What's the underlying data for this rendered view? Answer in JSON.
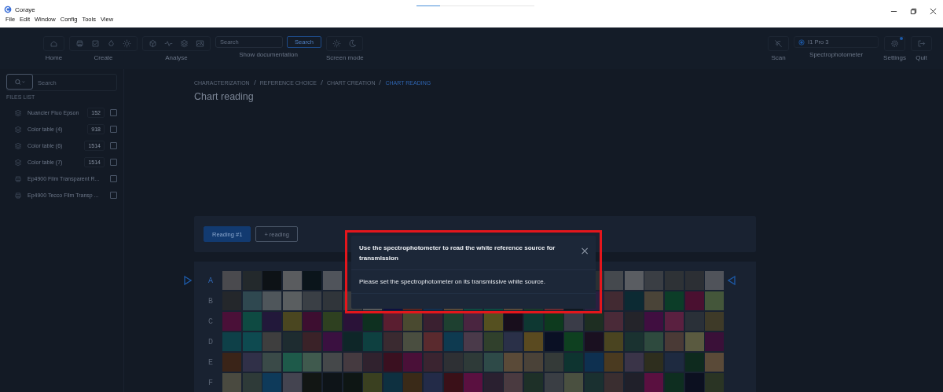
{
  "window": {
    "title": "Coraye",
    "menu": [
      "File",
      "Edit",
      "Window",
      "Config",
      "Tools",
      "View"
    ]
  },
  "toolbar": {
    "groups": [
      {
        "kind": "home",
        "label": "Home"
      },
      {
        "kind": "create",
        "label": "Create"
      },
      {
        "kind": "analyse",
        "label": "Analyse"
      }
    ],
    "search": {
      "placeholder": "Search",
      "button": "Search",
      "caption": "Show documentation"
    },
    "screen_mode": {
      "label": "Screen mode"
    },
    "scan": {
      "label": "Scan"
    },
    "spectrophotometer": {
      "value": "I1 Pro 3",
      "label": "Spectrophotometer",
      "connected": true
    },
    "settings": {
      "label": "Settings",
      "notification": true
    },
    "quit": {
      "label": "Quit"
    }
  },
  "sidebar": {
    "search": {
      "placeholder": "Search"
    },
    "heading": "FILES LIST",
    "files": [
      {
        "kind": "layers",
        "name": "Nuancier Fluo Epson",
        "count": "152",
        "checked": false
      },
      {
        "kind": "layers",
        "name": "Color table (4)",
        "count": "918",
        "checked": false
      },
      {
        "kind": "layers",
        "name": "Color table (6)",
        "count": "1514",
        "checked": false
      },
      {
        "kind": "layers",
        "name": "Color table (7)",
        "count": "1514",
        "checked": false
      },
      {
        "kind": "printer",
        "name": "Ep4900 Film Transparent R...",
        "checked": false
      },
      {
        "kind": "printer",
        "name": "Ep4900 Tecco Film Transp ...",
        "checked": false
      }
    ]
  },
  "breadcrumb": [
    {
      "label": "CHARACTERIZATION",
      "selected": false
    },
    {
      "label": "REFERENCE CHOICE",
      "selected": false
    },
    {
      "label": "CHART CREATION",
      "selected": false
    },
    {
      "label": "CHART READING",
      "selected": true
    }
  ],
  "page_title": "Chart reading",
  "readings": [
    {
      "label": "Reading #1",
      "selected": true
    },
    {
      "label": "+ reading",
      "selected": false
    }
  ],
  "chart": {
    "rows": [
      {
        "label": "A",
        "selected": true,
        "cells": [
          {
            "color": "#4a4a4e"
          },
          {
            "color": "#23292c"
          },
          {
            "color": "#0d1216"
          },
          {
            "color": "#5a5c5f"
          },
          {
            "color": "#0b151b"
          },
          {
            "color": "#50545b"
          },
          null,
          null,
          null,
          null,
          null,
          null,
          null,
          null,
          null,
          null,
          null,
          null,
          {
            "color": "#2b3034"
          },
          {
            "color": "#45494e"
          },
          {
            "color": "#5a5d62"
          },
          {
            "color": "#3a3e44"
          },
          {
            "color": "#2e3236"
          },
          {
            "color": "#2c2f34"
          },
          {
            "color": "#50535a"
          }
        ]
      },
      {
        "label": "B",
        "selected": false,
        "cells": [
          {
            "color": "#24272b"
          },
          {
            "color": "#2f4850"
          },
          {
            "color": "#4f565b"
          },
          {
            "color": "#5a5e60"
          },
          {
            "color": "#3a3f45"
          },
          {
            "color": "#30353a"
          },
          {
            "color": "#3a3d40"
          },
          {
            "color": "#5a5a5a"
          },
          {
            "color": "#0e1040"
          },
          {
            "color": "#5a2520"
          },
          {
            "color": "#123050"
          },
          {
            "color": "#5a4a38"
          },
          {
            "color": "#0f4a40"
          },
          {
            "color": "#0d4a40"
          },
          {
            "color": "#5a4a38"
          },
          {
            "color": "#1a3a2a"
          },
          {
            "color": "#6a2a30"
          },
          {
            "color": "#101820"
          },
          {
            "color": "#2a2040"
          },
          {
            "color": "#422a32"
          },
          {
            "color": "#0c2a33"
          },
          {
            "color": "#4a4438"
          },
          {
            "color": "#0c3d28"
          },
          {
            "color": "#4a1030"
          },
          {
            "color": "#44563a"
          }
        ]
      },
      {
        "label": "C",
        "selected": false,
        "cells": [
          {
            "color": "#4a1038"
          },
          {
            "color": "#0e4a42"
          },
          {
            "color": "#22183a"
          },
          {
            "color": "#4a4620"
          },
          {
            "color": "#3d0e30"
          },
          {
            "color": "#2e4020"
          },
          {
            "color": "#2a1238"
          },
          {
            "color": "#0e3020"
          },
          {
            "color": "#5a1e30"
          },
          {
            "color": "#4a4a30"
          },
          {
            "color": "#3a2030"
          },
          {
            "color": "#1e4030"
          },
          {
            "color": "#4a2540"
          },
          {
            "color": "#555020"
          },
          {
            "color": "#180e1c"
          },
          {
            "color": "#0e3832"
          },
          {
            "color": "#0d3a1e"
          },
          {
            "color": "#3a3c48"
          },
          {
            "color": "#1e2e22"
          },
          {
            "color": "#4a2a38"
          },
          {
            "color": "#24242a"
          },
          {
            "color": "#400e40"
          },
          {
            "color": "#5a2040"
          },
          {
            "color": "#2a3038"
          },
          {
            "color": "#3e3a28"
          }
        ]
      },
      {
        "label": "D",
        "selected": false,
        "cells": [
          {
            "color": "#0e4048"
          },
          {
            "color": "#0e4a50"
          },
          {
            "color": "#3e3e3e"
          },
          {
            "color": "#1e2c30"
          },
          {
            "color": "#3a2228"
          },
          {
            "color": "#3a1040"
          },
          {
            "color": "#0e2628"
          },
          {
            "color": "#0e4040"
          },
          {
            "color": "#3a2a30"
          },
          {
            "color": "#4a4e40"
          },
          {
            "color": "#5a2a2e"
          },
          {
            "color": "#0e3a50"
          },
          {
            "color": "#4a3a4a"
          },
          {
            "color": "#30402c"
          },
          {
            "color": "#2a3048"
          },
          {
            "color": "#5a4a20"
          },
          {
            "color": "#0a1024"
          },
          {
            "color": "#0e4020"
          },
          {
            "color": "#1a1020"
          },
          {
            "color": "#4a4420"
          },
          {
            "color": "#1a3230"
          },
          {
            "color": "#2e4a3e"
          },
          {
            "color": "#4a3a36"
          },
          {
            "color": "#5a5a40"
          },
          {
            "color": "#3a1038"
          }
        ]
      },
      {
        "label": "E",
        "selected": false,
        "cells": [
          {
            "color": "#3a2418"
          },
          {
            "color": "#303048"
          },
          {
            "color": "#3a4a48"
          },
          {
            "color": "#1e5a4a"
          },
          {
            "color": "#405a4e"
          },
          {
            "color": "#45484a"
          },
          {
            "color": "#453a40"
          },
          {
            "color": "#30222e"
          },
          {
            "color": "#3a1020"
          },
          {
            "color": "#4a1038"
          },
          {
            "color": "#3a2430"
          },
          {
            "color": "#2e3034"
          },
          {
            "color": "#2e3a38"
          },
          {
            "color": "#2e4a48"
          },
          {
            "color": "#5a4a38"
          },
          {
            "color": "#4a4238"
          },
          {
            "color": "#343a38"
          },
          {
            "color": "#0e3430"
          },
          {
            "color": "#0e3050"
          },
          {
            "color": "#4a3a20"
          },
          {
            "color": "#3a3448"
          },
          {
            "color": "#2e2e1e"
          },
          {
            "color": "#1e2a40"
          },
          {
            "color": "#0e2a1e"
          },
          {
            "color": "#5a4a38"
          }
        ]
      },
      {
        "label": "F",
        "selected": false,
        "cells": [
          {
            "color": "#4a4a40"
          },
          {
            "color": "#2e3a38"
          },
          {
            "color": "#0e3a5a"
          },
          {
            "color": "#444450"
          },
          {
            "color": "#121614"
          },
          {
            "color": "#0e1418"
          },
          {
            "color": "#0e1614"
          },
          {
            "color": "#3a4020"
          },
          {
            "color": "#0e3040"
          },
          {
            "color": "#3a2a18"
          },
          {
            "color": "#232b48"
          },
          {
            "color": "#3a1018"
          },
          {
            "color": "#5a1040"
          },
          {
            "color": "#2a2030"
          },
          {
            "color": "#4a3a40"
          },
          {
            "color": "#1e3028"
          },
          {
            "color": "#3a3e44"
          },
          {
            "color": "#4a5040"
          },
          {
            "color": "#1a3030"
          },
          {
            "color": "#3a2e30"
          },
          {
            "color": "#20202a"
          },
          {
            "color": "#5a1040"
          },
          {
            "color": "#0e2e20"
          },
          {
            "color": "#0c1020"
          },
          {
            "color": "#2a3424"
          }
        ]
      }
    ]
  },
  "dialog": {
    "title": "Use the spectrophotometer to read the white reference source for transmission",
    "close": "×",
    "message": "Please set the spectrophotometer on its transmissive white source.",
    "highlighted": true
  }
}
